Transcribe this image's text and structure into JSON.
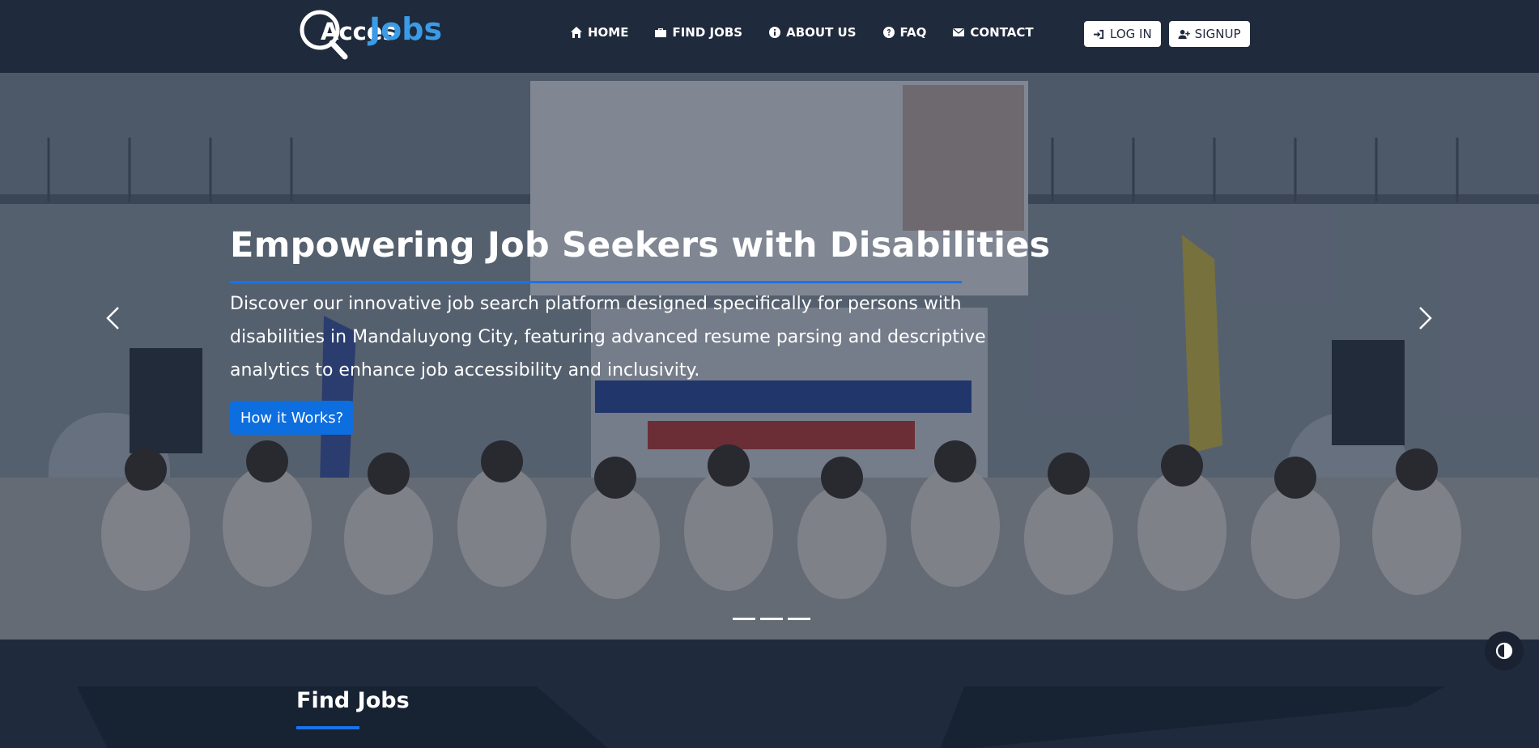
{
  "header": {
    "logo": {
      "text_a": "Acces",
      "text_j": "Jobs"
    },
    "nav": [
      {
        "label": "HOME",
        "icon": "home-icon"
      },
      {
        "label": "FIND JOBS",
        "icon": "briefcase-icon"
      },
      {
        "label": "ABOUT US",
        "icon": "info-icon"
      },
      {
        "label": "FAQ",
        "icon": "question-icon"
      },
      {
        "label": "CONTACT",
        "icon": "envelope-icon"
      }
    ],
    "login_label": "LOG IN",
    "signup_label": "SIGNUP"
  },
  "hero": {
    "title": "Empowering Job Seekers with Disabilities",
    "text": "Discover our innovative job search platform designed specifically for persons with disabilities in Mandaluyong City, featuring advanced resume parsing and descriptive analytics to enhance job accessibility and inclusivity.",
    "button_label": "How it Works?",
    "slides": 3
  },
  "section": {
    "title": "Find Jobs"
  },
  "colors": {
    "background": "#1f2a3c",
    "accent": "#1a73e8",
    "logo_blue": "#3a9be6"
  }
}
